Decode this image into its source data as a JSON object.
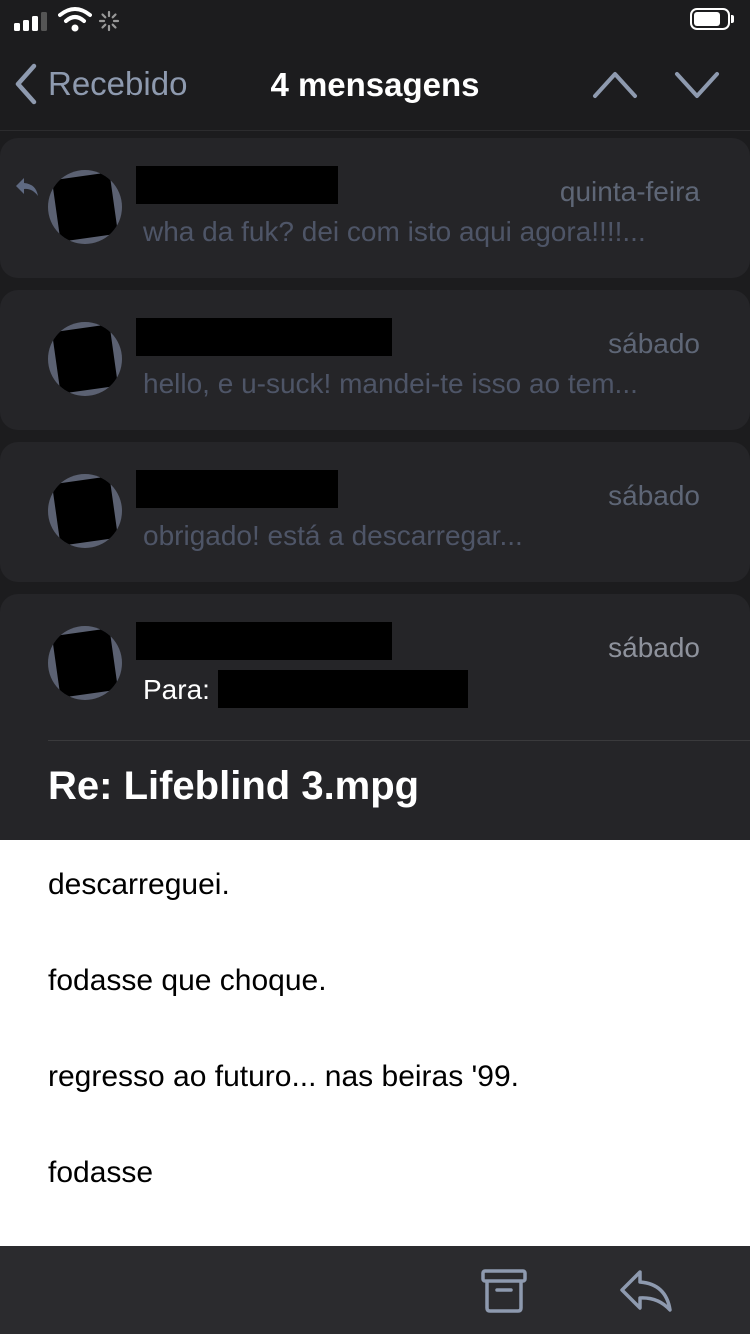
{
  "status_bar": {
    "icons": [
      "cellular-signal-icon",
      "wifi-icon",
      "activity-spinner-icon",
      "battery-icon"
    ]
  },
  "nav": {
    "back_label": "Recebido",
    "title": "4 mensagens",
    "icons": [
      "chevron-left-icon",
      "chevron-up-icon",
      "chevron-down-icon"
    ]
  },
  "thread": {
    "messages": [
      {
        "date": "quinta-feira",
        "preview": "wha da fuk? dei com isto aqui agora!!!!...",
        "replied": true
      },
      {
        "date": "sábado",
        "preview": "hello, e u-suck! mandei-te isso ao tem..."
      },
      {
        "date": "sábado",
        "preview": "obrigado! está a descarregar..."
      }
    ],
    "open": {
      "date": "sábado",
      "to_label": "Para:",
      "subject": "Re:  Lifeblind 3.mpg",
      "body": [
        "descarreguei.",
        "fodasse que choque.",
        "regresso ao futuro... nas beiras '99.",
        "fodasse"
      ]
    }
  },
  "toolbar": {
    "icons": [
      "archive-icon",
      "reply-icon"
    ]
  },
  "colors": {
    "background": "#1c1c1e",
    "card": "#252528",
    "accent": "#8e9aaf",
    "secondary_text": "#5e6676"
  }
}
